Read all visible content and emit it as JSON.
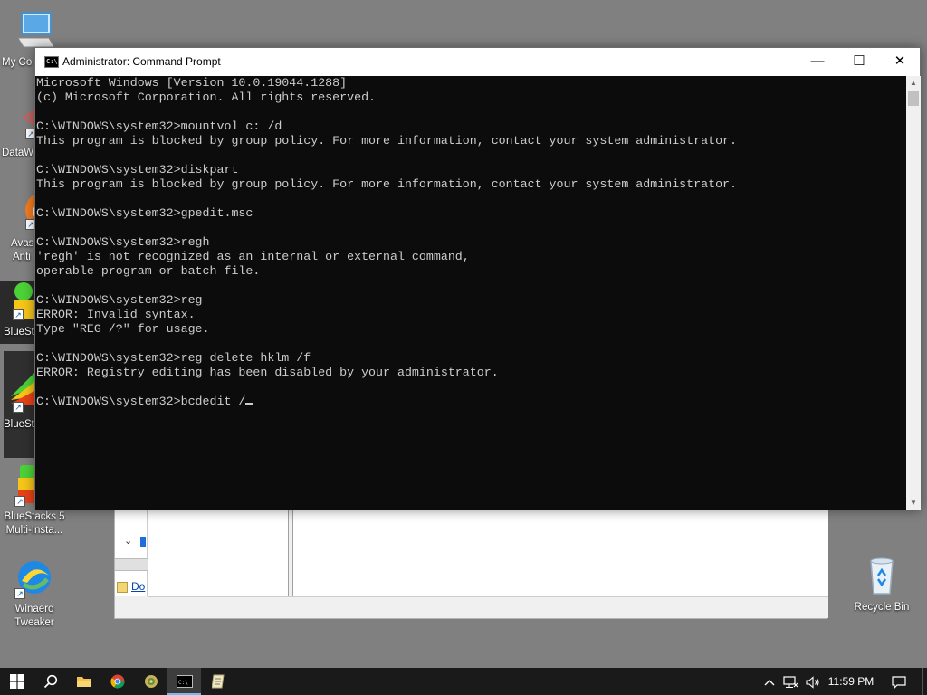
{
  "desktop": {
    "icons": {
      "my_computer": "My Co",
      "datawrapper": "DataW",
      "avast_1": "Avas",
      "avast_2": "Anti",
      "bluestacks_1": "BlueSt",
      "bluestacks_2": "BlueSt",
      "bluestacks_multi_1": "BlueStacks 5",
      "bluestacks_multi_2": "Multi-Insta...",
      "winaero_1": "Winaero",
      "winaero_2": "Tweaker",
      "recycle_bin": "Recycle Bin"
    },
    "background_window": {
      "link_text": "Do"
    }
  },
  "cmd_window": {
    "title": "Administrator: Command Prompt",
    "app_icon_text": "C:\\",
    "controls": {
      "minimize": "—",
      "maximize": "☐",
      "close": "✕"
    },
    "console_text": "Microsoft Windows [Version 10.0.19044.1288]\n(c) Microsoft Corporation. All rights reserved.\n\nC:\\WINDOWS\\system32>mountvol c: /d\nThis program is blocked by group policy. For more information, contact your system administrator.\n\nC:\\WINDOWS\\system32>diskpart\nThis program is blocked by group policy. For more information, contact your system administrator.\n\nC:\\WINDOWS\\system32>gpedit.msc\n\nC:\\WINDOWS\\system32>regh\n'regh' is not recognized as an internal or external command,\noperable program or batch file.\n\nC:\\WINDOWS\\system32>reg\nERROR: Invalid syntax.\nType \"REG /?\" for usage.\n\nC:\\WINDOWS\\system32>reg delete hklm /f\nERROR: Registry editing has been disabled by your administrator.\n\nC:\\WINDOWS\\system32>bcdedit /",
    "colors": {
      "console_bg": "#0c0c0c",
      "console_fg": "#cccccc"
    }
  },
  "taskbar": {
    "clock": "11:59 PM",
    "apps": [
      "start-icon",
      "search-icon",
      "file-explorer-icon",
      "chrome-icon",
      "pinned-app-icon",
      "command-prompt-icon",
      "notepad-icon"
    ],
    "tray": [
      "chevron-up-icon",
      "network-icon",
      "volume-icon",
      "notification-icon"
    ],
    "accent": "#76b9ed"
  }
}
